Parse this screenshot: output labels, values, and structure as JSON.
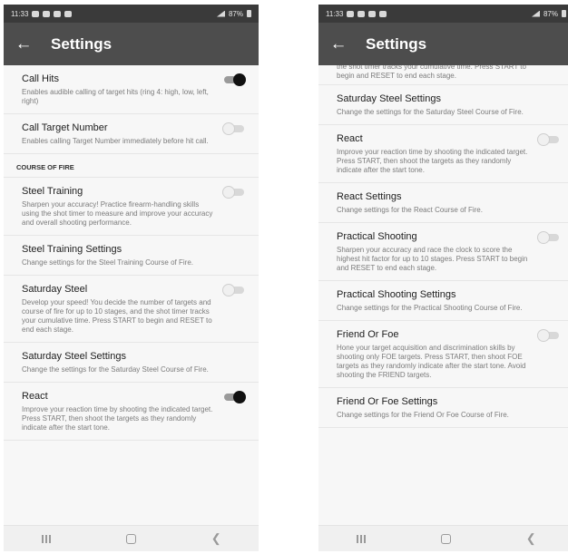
{
  "status_bar": {
    "time": "11:33",
    "battery": "87%"
  },
  "left": {
    "title": "Settings",
    "items_top": [
      {
        "title": "Call Hits",
        "desc": "Enables audible calling of target hits (ring 4: high, low, left, right)",
        "toggle": true
      },
      {
        "title": "Call Target Number",
        "desc": "Enables calling Target Number immediately before hit call.",
        "toggle": false
      }
    ],
    "section_header": "COURSE OF FIRE",
    "items": [
      {
        "title": "Steel Training",
        "desc": "Sharpen your accuracy! Practice firearm-handling skills using the shot timer to measure and improve your accuracy and overall shooting performance.",
        "toggle": false
      },
      {
        "title": "Steel Training Settings",
        "desc": "Change settings for the Steel Training Course of Fire."
      },
      {
        "title": "Saturday Steel",
        "desc": "Develop your speed! You decide the number of targets and course of fire for up to 10 stages, and the shot timer tracks your cumulative time. Press START to begin and RESET to end each stage.",
        "toggle": false
      },
      {
        "title": "Saturday Steel Settings",
        "desc": "Change the settings for the Saturday Steel Course of Fire."
      },
      {
        "title": "React",
        "desc": "Improve your reaction time by shooting the indicated target. Press START, then shoot the targets as they randomly indicate after the start tone.",
        "toggle": true
      }
    ]
  },
  "right": {
    "title": "Settings",
    "top_partial": "the shot timer tracks your cumulative time. Press START to begin and RESET to end each stage.",
    "items": [
      {
        "title": "Saturday Steel Settings",
        "desc": "Change the settings for the Saturday Steel Course of Fire."
      },
      {
        "title": "React",
        "desc": "Improve your reaction time by shooting the indicated target. Press START, then shoot the targets as they randomly indicate after the start tone.",
        "toggle": false
      },
      {
        "title": "React Settings",
        "desc": "Change settings for the React Course of Fire."
      },
      {
        "title": "Practical Shooting",
        "desc": "Sharpen your accuracy and race the clock to score the highest hit factor for up to 10 stages. Press START to begin and RESET to end each stage.",
        "toggle": false
      },
      {
        "title": "Practical Shooting Settings",
        "desc": "Change settings for the Practical Shooting Course of Fire."
      },
      {
        "title": "Friend Or Foe",
        "desc": "Hone your target acquisition and discrimination skills by shooting only FOE targets. Press START, then shoot FOE targets as they randomly indicate after the start tone. Avoid shooting the FRIEND targets.",
        "toggle": false
      },
      {
        "title": "Friend Or Foe Settings",
        "desc": "Change settings for the Friend Or Foe Course of Fire."
      }
    ]
  },
  "icons": {
    "back": "arrow-left-icon",
    "recents": "recents-icon",
    "home": "home-icon",
    "nav_back": "nav-back-icon"
  },
  "colors": {
    "app_bar": "#4d4d4d",
    "status_bar": "#3a3a3a",
    "toggle_on": "#111111",
    "background": "#f7f7f7"
  }
}
